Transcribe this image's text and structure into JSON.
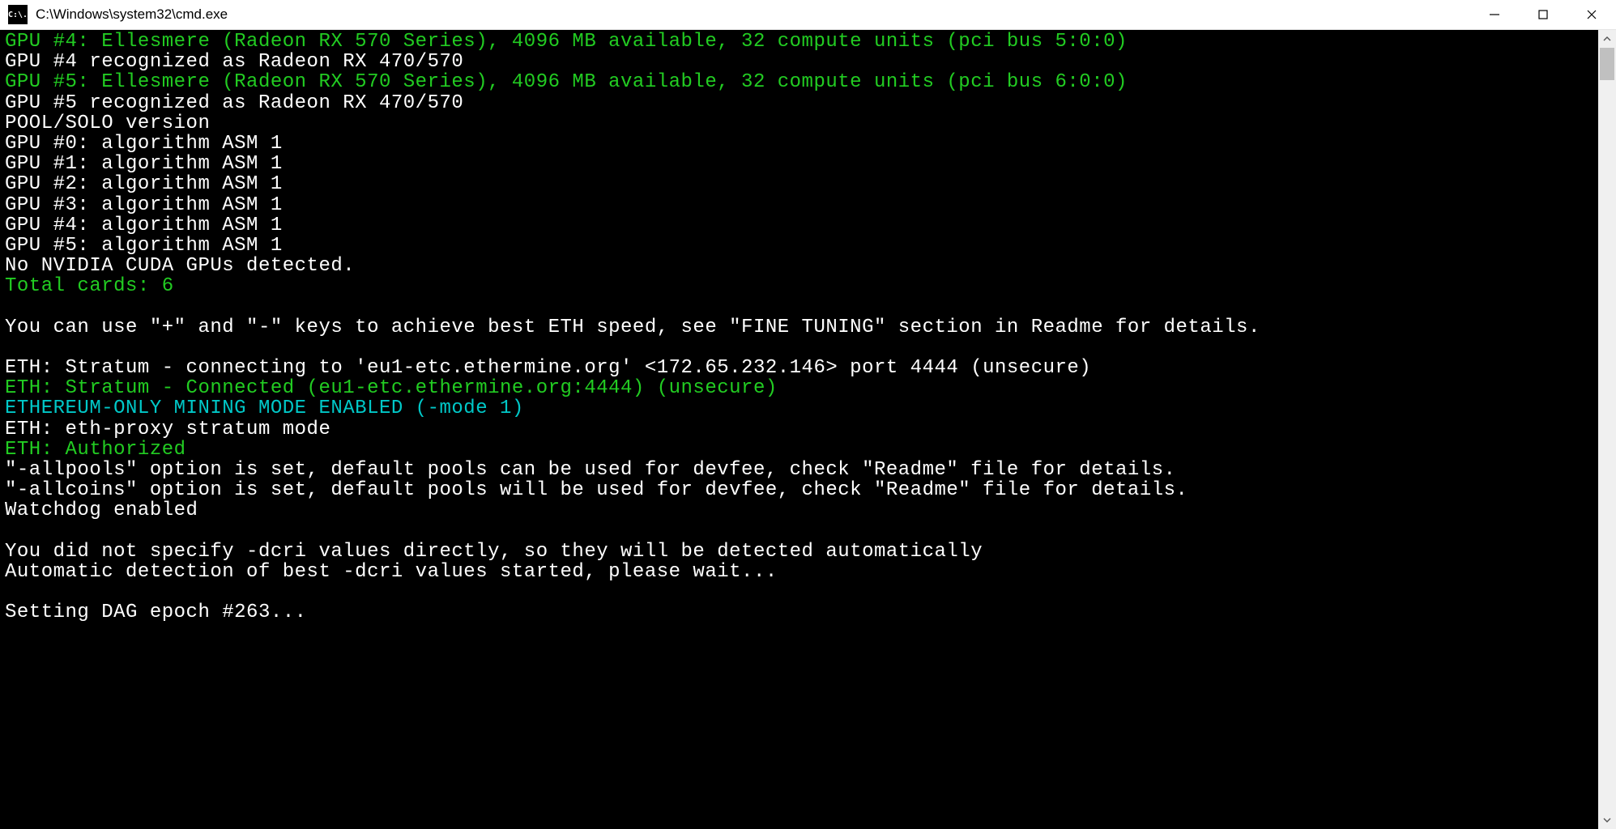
{
  "window": {
    "icon_text": "C:\\.",
    "title": "C:\\Windows\\system32\\cmd.exe"
  },
  "lines": [
    {
      "cls": "green",
      "text": "GPU #4: Ellesmere (Radeon RX 570 Series), 4096 MB available, 32 compute units (pci bus 5:0:0)"
    },
    {
      "cls": "white",
      "text": "GPU #4 recognized as Radeon RX 470/570"
    },
    {
      "cls": "green",
      "text": "GPU #5: Ellesmere (Radeon RX 570 Series), 4096 MB available, 32 compute units (pci bus 6:0:0)"
    },
    {
      "cls": "white",
      "text": "GPU #5 recognized as Radeon RX 470/570"
    },
    {
      "cls": "white",
      "text": "POOL/SOLO version"
    },
    {
      "cls": "white",
      "text": "GPU #0: algorithm ASM 1"
    },
    {
      "cls": "white",
      "text": "GPU #1: algorithm ASM 1"
    },
    {
      "cls": "white",
      "text": "GPU #2: algorithm ASM 1"
    },
    {
      "cls": "white",
      "text": "GPU #3: algorithm ASM 1"
    },
    {
      "cls": "white",
      "text": "GPU #4: algorithm ASM 1"
    },
    {
      "cls": "white",
      "text": "GPU #5: algorithm ASM 1"
    },
    {
      "cls": "white",
      "text": "No NVIDIA CUDA GPUs detected."
    },
    {
      "cls": "green",
      "text": "Total cards: 6"
    },
    {
      "cls": "white",
      "text": ""
    },
    {
      "cls": "white",
      "text": "You can use \"+\" and \"-\" keys to achieve best ETH speed, see \"FINE TUNING\" section in Readme for details."
    },
    {
      "cls": "white",
      "text": ""
    },
    {
      "cls": "white",
      "text": "ETH: Stratum - connecting to 'eu1-etc.ethermine.org' <172.65.232.146> port 4444 (unsecure)"
    },
    {
      "cls": "green",
      "text": "ETH: Stratum - Connected (eu1-etc.ethermine.org:4444) (unsecure)"
    },
    {
      "cls": "cyan",
      "text": "ETHEREUM-ONLY MINING MODE ENABLED (-mode 1)"
    },
    {
      "cls": "white",
      "text": "ETH: eth-proxy stratum mode"
    },
    {
      "cls": "green",
      "text": "ETH: Authorized"
    },
    {
      "cls": "white",
      "text": "\"-allpools\" option is set, default pools can be used for devfee, check \"Readme\" file for details."
    },
    {
      "cls": "white",
      "text": "\"-allcoins\" option is set, default pools will be used for devfee, check \"Readme\" file for details."
    },
    {
      "cls": "white",
      "text": "Watchdog enabled"
    },
    {
      "cls": "white",
      "text": ""
    },
    {
      "cls": "white",
      "text": "You did not specify -dcri values directly, so they will be detected automatically"
    },
    {
      "cls": "white",
      "text": "Automatic detection of best -dcri values started, please wait..."
    },
    {
      "cls": "white",
      "text": ""
    },
    {
      "cls": "white",
      "text": "Setting DAG epoch #263..."
    }
  ]
}
